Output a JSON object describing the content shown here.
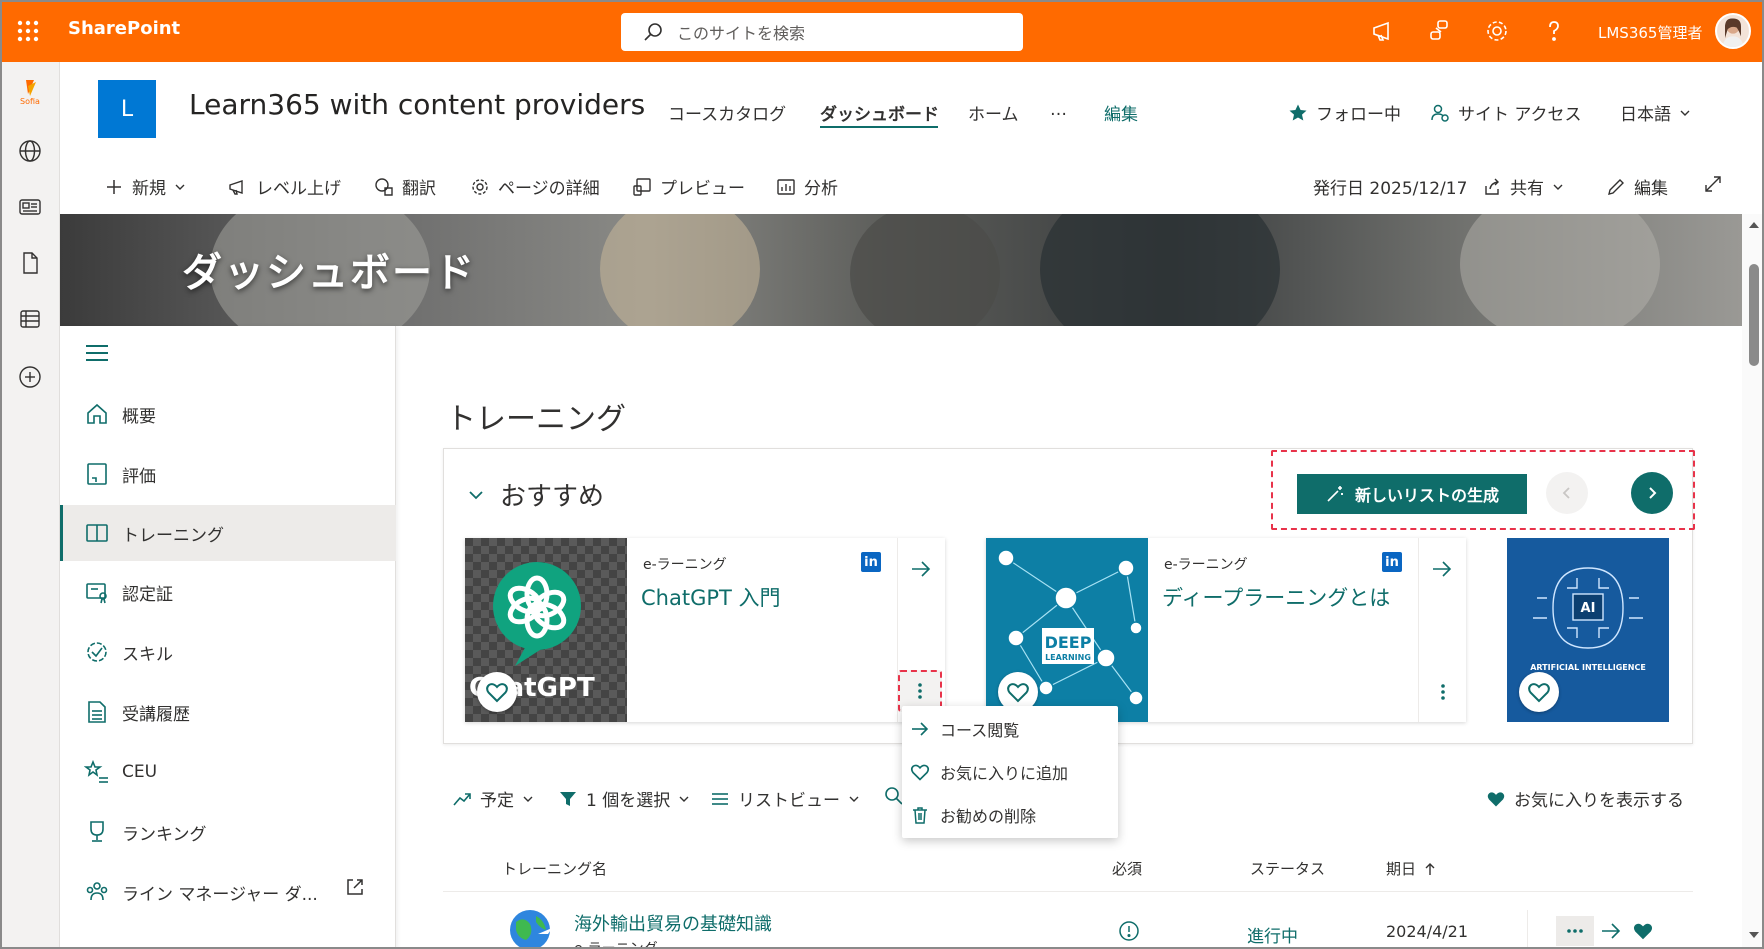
{
  "suite": {
    "brand": "SharePoint",
    "search_placeholder": "このサイトを検索",
    "user_name": "LMS365管理者"
  },
  "rail": {
    "logo_text": "Sofia"
  },
  "site": {
    "logo_letter": "L",
    "title": "Learn365 with content providers",
    "nav": [
      "コースカタログ",
      "ダッシュボード",
      "ホーム",
      "…",
      "編集"
    ],
    "follow": "フォロー中",
    "site_access": "サイト アクセス",
    "language": "日本語"
  },
  "commandbar": {
    "new": "新規",
    "level_up": "レベル上げ",
    "translate": "翻訳",
    "page_details": "ページの詳細",
    "preview": "プレビュー",
    "analytics": "分析",
    "published": "発行日 2025/12/17",
    "share": "共有",
    "edit": "編集"
  },
  "banner": {
    "title": "ダッシュボード"
  },
  "leftnav": {
    "items": [
      "概要",
      "評価",
      "トレーニング",
      "認定証",
      "スキル",
      "受講履歴",
      "CEU",
      "ランキング",
      "ライン マネージャー ダ..."
    ]
  },
  "main": {
    "heading": "トレーニング",
    "recommended": {
      "title": "おすすめ",
      "generate_button": "新しいリストの生成",
      "cards": [
        {
          "type": "e-ラーニング",
          "title": "ChatGPT 入門",
          "image_text": "ChatGPT"
        },
        {
          "type": "e-ラーニング",
          "title": "ディープラーニングとは",
          "image_text": "DEEP LEARNING"
        },
        {
          "type": "",
          "title": "",
          "image_text": "AI",
          "image_subtext": "ARTIFICIAL INTELLIGENCE"
        }
      ]
    },
    "context_menu": [
      "コース閲覧",
      "お気に入りに追加",
      "お勧めの削除"
    ],
    "filters": {
      "schedule": "予定",
      "select": "1 個を選択",
      "list_view": "リストビュー",
      "show_favorites": "お気に入りを表示する"
    },
    "table": {
      "headers": {
        "name": "トレーニング名",
        "required": "必須",
        "status": "ステータス",
        "due": "期日"
      },
      "rows": [
        {
          "name": "海外輸出貿易の基礎知識",
          "type": "e-ラーニング",
          "status": "進行中",
          "due": "2024/4/21"
        }
      ]
    }
  },
  "colors": {
    "suitebar": "#ff6a00",
    "accent": "#0f6d6a",
    "site_logo": "#0078d4",
    "highlight": "#e8334a"
  }
}
